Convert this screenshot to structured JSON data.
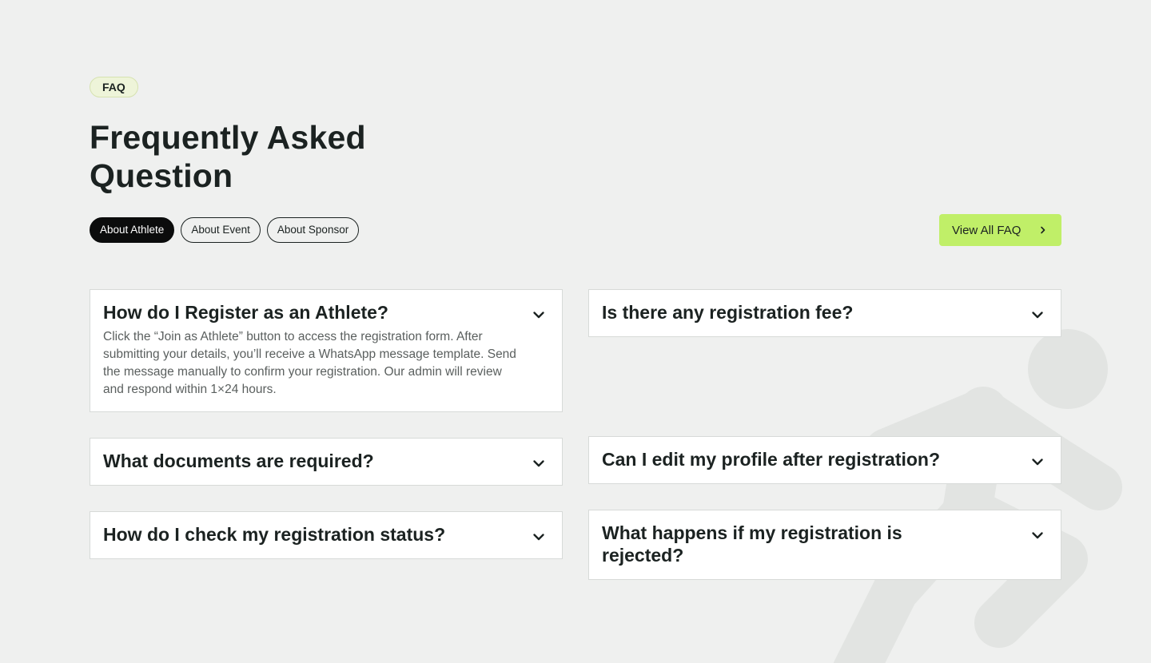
{
  "section": {
    "badge": "FAQ",
    "title": "Frequently Asked Question"
  },
  "tabs": [
    {
      "label": "About Athlete",
      "active": true
    },
    {
      "label": "About Event",
      "active": false
    },
    {
      "label": "About Sponsor",
      "active": false
    }
  ],
  "view_all": {
    "label": "View All FAQ",
    "icon": "chevron-right-icon"
  },
  "faqs": [
    {
      "question": "How do I Register as an Athlete?",
      "answer": "Click the “Join as Athlete” button to access the registration form. After submitting your details, you’ll receive a WhatsApp message template. Send the message manually to confirm your registration. Our admin will review and respond within 1×24 hours.",
      "expanded": true
    },
    {
      "question": "Is there any registration fee?",
      "expanded": false
    },
    {
      "question": "What documents are required?",
      "expanded": false
    },
    {
      "question": "Can I edit my profile after registration?",
      "expanded": false
    },
    {
      "question": "How do I check my registration status?",
      "expanded": false
    },
    {
      "question": "What happens if my registration is rejected?",
      "expanded": false
    }
  ],
  "colors": {
    "background": "#eff0ef",
    "accent": "#c0ef68",
    "badge_bg": "#eef4d9",
    "text": "#1b2221",
    "muted": "#5a5f5e"
  }
}
